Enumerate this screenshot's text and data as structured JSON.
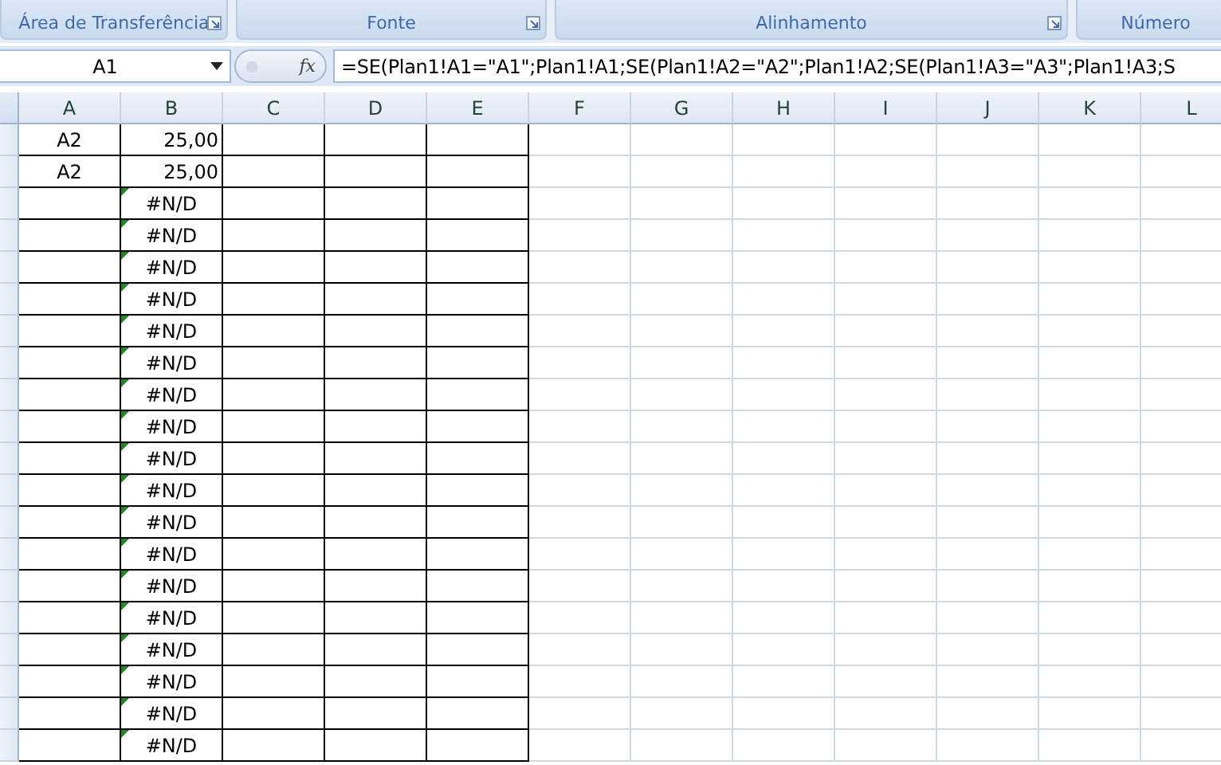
{
  "ribbon_groups": [
    {
      "label": "Área de Transferência",
      "launcher": true
    },
    {
      "label": "Fonte",
      "launcher": true
    },
    {
      "label": "Alinhamento",
      "launcher": true
    },
    {
      "label": "Número",
      "launcher": false
    }
  ],
  "name_box": {
    "value": "A1"
  },
  "formula_bar": {
    "fx_label": "fx",
    "value": "=SE(Plan1!A1=\"A1\";Plan1!A1;SE(Plan1!A2=\"A2\";Plan1!A2;SE(Plan1!A3=\"A3\";Plan1!A3;S"
  },
  "columns": [
    "A",
    "B",
    "C",
    "D",
    "E",
    "F",
    "G",
    "H",
    "I",
    "J",
    "K",
    "L"
  ],
  "rows": [
    {
      "A": {
        "text": "A2",
        "kind": "text"
      },
      "B": {
        "text": "25,00",
        "kind": "number"
      }
    },
    {
      "A": {
        "text": "A2",
        "kind": "text"
      },
      "B": {
        "text": "25,00",
        "kind": "number"
      }
    },
    {
      "B": {
        "text": "#N/D",
        "kind": "error"
      }
    },
    {
      "B": {
        "text": "#N/D",
        "kind": "error"
      }
    },
    {
      "B": {
        "text": "#N/D",
        "kind": "error"
      }
    },
    {
      "B": {
        "text": "#N/D",
        "kind": "error"
      }
    },
    {
      "B": {
        "text": "#N/D",
        "kind": "error"
      }
    },
    {
      "B": {
        "text": "#N/D",
        "kind": "error"
      }
    },
    {
      "B": {
        "text": "#N/D",
        "kind": "error"
      }
    },
    {
      "B": {
        "text": "#N/D",
        "kind": "error"
      }
    },
    {
      "B": {
        "text": "#N/D",
        "kind": "error"
      }
    },
    {
      "B": {
        "text": "#N/D",
        "kind": "error"
      }
    },
    {
      "B": {
        "text": "#N/D",
        "kind": "error"
      }
    },
    {
      "B": {
        "text": "#N/D",
        "kind": "error"
      }
    },
    {
      "B": {
        "text": "#N/D",
        "kind": "error"
      }
    },
    {
      "B": {
        "text": "#N/D",
        "kind": "error"
      }
    },
    {
      "B": {
        "text": "#N/D",
        "kind": "error"
      }
    },
    {
      "B": {
        "text": "#N/D",
        "kind": "error"
      }
    },
    {
      "B": {
        "text": "#N/D",
        "kind": "error"
      }
    },
    {
      "B": {
        "text": "#N/D",
        "kind": "error"
      }
    }
  ]
}
